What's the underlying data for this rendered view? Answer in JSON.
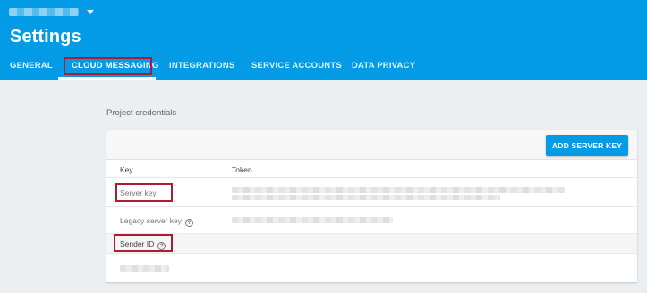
{
  "header": {
    "title": "Settings",
    "background_color": "#039be5",
    "project_picker_icon": "chevron-down-icon"
  },
  "tabs": [
    {
      "label": "GENERAL",
      "active": false
    },
    {
      "label": "CLOUD MESSAGING",
      "active": true
    },
    {
      "label": "INTEGRATIONS",
      "active": false
    },
    {
      "label": "SERVICE ACCOUNTS",
      "active": false
    },
    {
      "label": "DATA PRIVACY",
      "active": false
    }
  ],
  "section": {
    "title": "Project credentials"
  },
  "card": {
    "add_button_label": "ADD SERVER KEY",
    "columns": {
      "key": "Key",
      "token": "Token"
    },
    "rows": [
      {
        "key": "Server key"
      },
      {
        "key": "Legacy server key",
        "help_icon": "help-circle-icon",
        "help_glyph": "?"
      }
    ],
    "sender": {
      "label": "Sender ID",
      "help_icon": "help-circle-icon",
      "help_glyph": "?"
    }
  },
  "highlight_color": "#b01c2e"
}
